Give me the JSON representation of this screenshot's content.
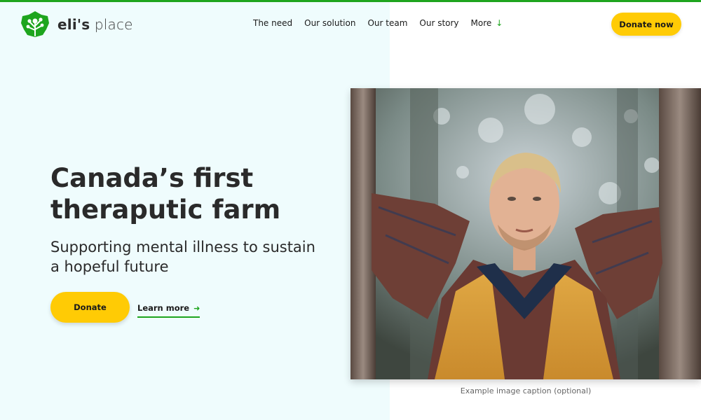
{
  "brand": {
    "name_bold": "eli's",
    "name_light": "place",
    "logo_icon": "tree-leaf-icon",
    "accent": "#1ea51e"
  },
  "nav": {
    "items": [
      "The need",
      "Our solution",
      "Our team",
      "Our story"
    ],
    "more_label": "More",
    "more_icon": "arrow-down-icon"
  },
  "header": {
    "donate_label": "Donate now",
    "button_color": "#ffcb05"
  },
  "hero": {
    "title_line1": "Canada’s first",
    "title_line2": "theraputic farm",
    "subtitle_line1": "Supporting mental illness to sustain",
    "subtitle_line2": "a hopeful future",
    "donate_label": "Donate",
    "learn_more_label": "Learn more",
    "learn_more_icon": "arrow-right-icon"
  },
  "image": {
    "caption": "Example image caption (optional)"
  }
}
